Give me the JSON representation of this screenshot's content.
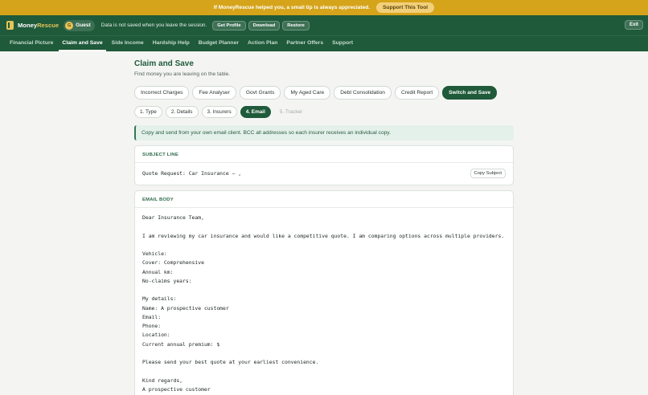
{
  "banner": {
    "text": "If MoneyRescue helped you, a small tip is always appreciated.",
    "cta": "Support This Tool"
  },
  "topbar": {
    "logo_main": "Money",
    "logo_accent": "Rescue",
    "user_initial": "G",
    "user_name": "Guest",
    "notice": "Data is not saved when you leave the session.",
    "get_profile": "Get Profile",
    "download": "Download",
    "restore": "Restore",
    "exit": "Exit"
  },
  "nav": {
    "items": [
      "Financial Picture",
      "Claim and Save",
      "Side Income",
      "Hardship Help",
      "Budget Planner",
      "Action Plan",
      "Partner Offers",
      "Support"
    ],
    "active": "Claim and Save"
  },
  "page": {
    "title": "Claim and Save",
    "subtitle": "Find money you are leaving on the table."
  },
  "tool_tabs": {
    "items": [
      "Incorrect Charges",
      "Fee Analyser",
      "Govt Grants",
      "My Aged Care",
      "Debt Consolidation",
      "Credit Report",
      "Switch and Save"
    ],
    "active": "Switch and Save"
  },
  "steps": {
    "items": [
      "1. Type",
      "2. Details",
      "3. Insurers",
      "4. Email",
      "5. Tracker"
    ],
    "active": "4. Email",
    "disabled": [
      "5. Tracker"
    ]
  },
  "info": {
    "text": "Copy and send from your own email client. BCC all addresses so each insurer receives an individual copy."
  },
  "subject": {
    "label": "SUBJECT LINE",
    "value": "Quote Request: Car Insurance — ,",
    "copy_label": "Copy Subject"
  },
  "email_body": {
    "label": "EMAIL BODY",
    "lines": [
      "Dear Insurance Team,",
      "",
      "I am reviewing my car insurance and would like a competitive quote. I am comparing options across multiple providers.",
      "",
      "Vehicle:",
      "Cover: Comprehensive",
      "Annual km:",
      "No-claims years:",
      "",
      "My details:",
      "Name: A prospective customer",
      "Email:",
      "Phone:",
      "Location:",
      "Current annual premium: $",
      "",
      "Please send your best quote at your earliest convenience.",
      "",
      "Kind regards,",
      "A prospective customer"
    ]
  },
  "colors": {
    "brand_green": "#1f5a3a",
    "banner_gold": "#d5a41a",
    "accent_gold": "#e6c457",
    "info_bg": "#e4f1ea"
  }
}
